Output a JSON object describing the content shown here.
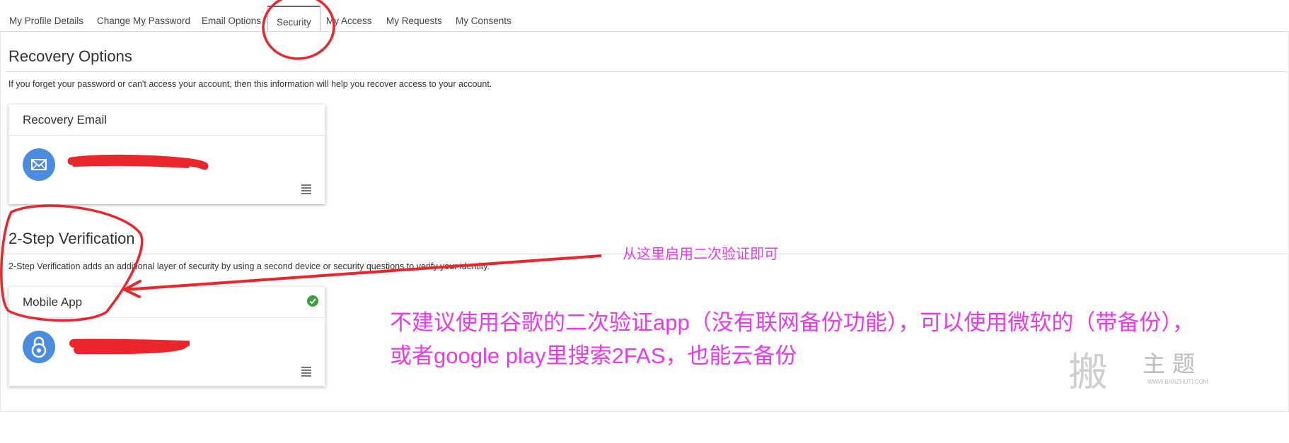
{
  "tabs": {
    "profile": "My Profile Details",
    "password": "Change My Password",
    "email": "Email Options",
    "security": "Security",
    "access": "My Access",
    "requests": "My Requests",
    "consents": "My Consents"
  },
  "recovery": {
    "title": "Recovery Options",
    "description": "If you forget your password or can't access your account, then this information will help you recover access to your account.",
    "card_title": "Recovery Email"
  },
  "two_step": {
    "title": "2-Step Verification",
    "description": "2-Step Verification adds an additional layer of security by using a second device or security questions to verify your identity.",
    "card_title": "Mobile App"
  },
  "annotations": {
    "arrow_note": "从这里启用二次验证即可",
    "note_line1": "不建议使用谷歌的二次验证app（没有联网备份功能），可以使用微软的（带备份），",
    "note_line2": "或者google play里搜索2FAS，也能云备份",
    "color": "#e33de6"
  },
  "watermark": {
    "char": "搬",
    "text": "主 题",
    "url": "WWW.BANZHUTI.COM"
  },
  "colors": {
    "accent_blue": "#4a8de0",
    "success_green": "#3c9f3c",
    "redaction_red": "#e8262c"
  },
  "icons": [
    "envelope-icon",
    "lock-icon",
    "menu-icon",
    "check-circle-icon"
  ]
}
